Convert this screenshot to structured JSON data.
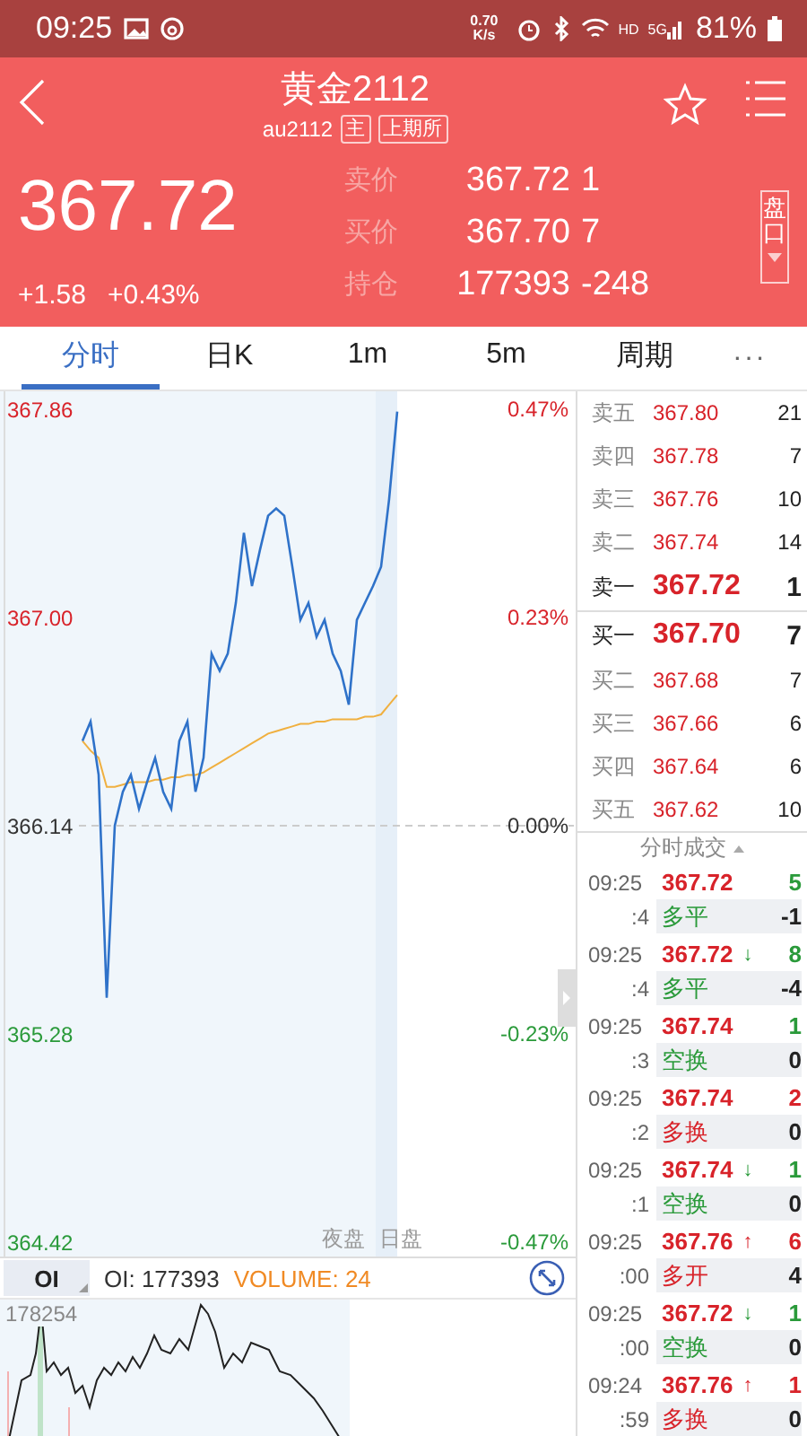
{
  "status_bar": {
    "time": "09:25",
    "speed": "0.70",
    "speed_unit": "K/s",
    "hd": "HD",
    "network": "5G",
    "battery": "81%"
  },
  "header": {
    "title": "黄金2112",
    "code": "au2112",
    "tags": [
      "主",
      "上期所"
    ]
  },
  "quote": {
    "price": "367.72",
    "change": "+1.58",
    "change_pct": "+0.43%",
    "panel_button": "盘口",
    "rows": [
      {
        "label": "卖价",
        "value": "367.72",
        "extra": "1"
      },
      {
        "label": "买价",
        "value": "367.70",
        "extra": "7"
      },
      {
        "label": "持仓",
        "value": "177393",
        "extra": "-248"
      }
    ]
  },
  "tabs": [
    {
      "label": "分时",
      "selected": true
    },
    {
      "label": "日K",
      "selected": false
    },
    {
      "label": "1m",
      "selected": false
    },
    {
      "label": "5m",
      "selected": false
    },
    {
      "label": "周期",
      "selected": false
    }
  ],
  "more_button": "···",
  "chart": {
    "right_ticks": [
      "0.47%",
      "0.23%",
      "0.00%",
      "-0.23%",
      "-0.47%"
    ],
    "sessions": [
      "夜盘",
      "日盘"
    ],
    "chart_data": {
      "type": "line",
      "ylim": [
        364.42,
        367.86
      ],
      "yticks": [
        {
          "value": 367.86,
          "label": "367.86"
        },
        {
          "value": 367.0,
          "label": "367.00"
        },
        {
          "value": 366.14,
          "label": "366.14"
        },
        {
          "value": 365.28,
          "label": "365.28"
        },
        {
          "value": 364.42,
          "label": "364.42"
        }
      ],
      "series": [
        {
          "color": "#2f72c9",
          "values": [
            366.49,
            366.57,
            366.35,
            365.43,
            366.14,
            366.28,
            366.35,
            366.21,
            366.32,
            366.42,
            366.28,
            366.21,
            366.49,
            366.57,
            366.28,
            366.42,
            366.85,
            366.78,
            366.85,
            367.06,
            367.35,
            367.13,
            367.28,
            367.42,
            367.45,
            367.42,
            367.21,
            366.99,
            367.06,
            366.92,
            366.99,
            366.85,
            366.78,
            366.64,
            366.99,
            367.06,
            367.13,
            367.21,
            367.49,
            367.85,
            null,
            null,
            null,
            null,
            null,
            null,
            null,
            null,
            null,
            null,
            null,
            null,
            null,
            null,
            null,
            null,
            null,
            null,
            null,
            null,
            null
          ]
        },
        {
          "color": "#f0b040",
          "values": [
            366.49,
            366.45,
            366.42,
            366.3,
            366.3,
            366.31,
            366.32,
            366.32,
            366.32,
            366.33,
            366.33,
            366.34,
            366.34,
            366.35,
            366.35,
            366.36,
            366.38,
            366.4,
            366.42,
            366.44,
            366.46,
            366.48,
            366.5,
            366.52,
            366.53,
            366.54,
            366.55,
            366.56,
            366.56,
            366.57,
            366.57,
            366.58,
            366.58,
            366.58,
            366.58,
            366.59,
            366.59,
            366.6,
            366.64,
            366.68,
            null,
            null,
            null,
            null,
            null,
            null,
            null,
            null,
            null,
            null,
            null,
            null,
            null,
            null,
            null,
            null,
            null,
            null,
            null,
            null,
            null
          ]
        }
      ]
    }
  },
  "indicator": {
    "selector": "OI",
    "oi": "OI: 177393",
    "volume": "VOLUME: 24",
    "scale": "178254"
  },
  "order_book": [
    {
      "label": "卖五",
      "price": "367.80",
      "qty": "21",
      "kind": "level"
    },
    {
      "label": "卖四",
      "price": "367.78",
      "qty": "7",
      "kind": "level"
    },
    {
      "label": "卖三",
      "price": "367.76",
      "qty": "10",
      "kind": "level"
    },
    {
      "label": "卖二",
      "price": "367.74",
      "qty": "14",
      "kind": "level"
    },
    {
      "label": "卖一",
      "price": "367.72",
      "qty": "1",
      "kind": "best"
    },
    {
      "label": "买一",
      "price": "367.70",
      "qty": "7",
      "kind": "best"
    },
    {
      "label": "买二",
      "price": "367.68",
      "qty": "7",
      "kind": "level"
    },
    {
      "label": "买三",
      "price": "367.66",
      "qty": "6",
      "kind": "level"
    },
    {
      "label": "买四",
      "price": "367.64",
      "qty": "6",
      "kind": "level"
    },
    {
      "label": "买五",
      "price": "367.62",
      "qty": "10",
      "kind": "level"
    }
  ],
  "trades": {
    "title": "分时成交",
    "items": [
      {
        "time": "09:25",
        "price": "367.72",
        "qty": "5",
        "seconds": ":4",
        "type": "多平",
        "change": "-1",
        "color": "#2a9a3a"
      },
      {
        "time": "09:25",
        "price": "367.72",
        "arrow": "↓",
        "qty": "8",
        "seconds": ":4",
        "type": "多平",
        "change": "-4",
        "color": "#2a9a3a"
      },
      {
        "time": "09:25",
        "price": "367.74",
        "qty": "1",
        "seconds": ":3",
        "type": "空换",
        "change": "0",
        "color": "#2a9a3a"
      },
      {
        "time": "09:25",
        "price": "367.74",
        "qty": "2",
        "seconds": ":2",
        "type": "多换",
        "change": "0",
        "color": "#d8232a"
      },
      {
        "time": "09:25",
        "price": "367.74",
        "arrow": "↓",
        "qty": "1",
        "seconds": ":1",
        "type": "空换",
        "change": "0",
        "color": "#2a9a3a"
      },
      {
        "time": "09:25",
        "price": "367.76",
        "arrow": "↑",
        "qty": "6",
        "seconds": ":00",
        "type": "多开",
        "change": "4",
        "color": "#d8232a"
      },
      {
        "time": "09:25",
        "price": "367.72",
        "arrow": "↓",
        "qty": "1",
        "seconds": ":00",
        "type": "空换",
        "change": "0",
        "color": "#2a9a3a"
      },
      {
        "time": "09:24",
        "price": "367.76",
        "arrow": "↑",
        "qty": "1",
        "seconds": ":59",
        "type": "多换",
        "change": "0",
        "color": "#d8232a"
      }
    ]
  }
}
